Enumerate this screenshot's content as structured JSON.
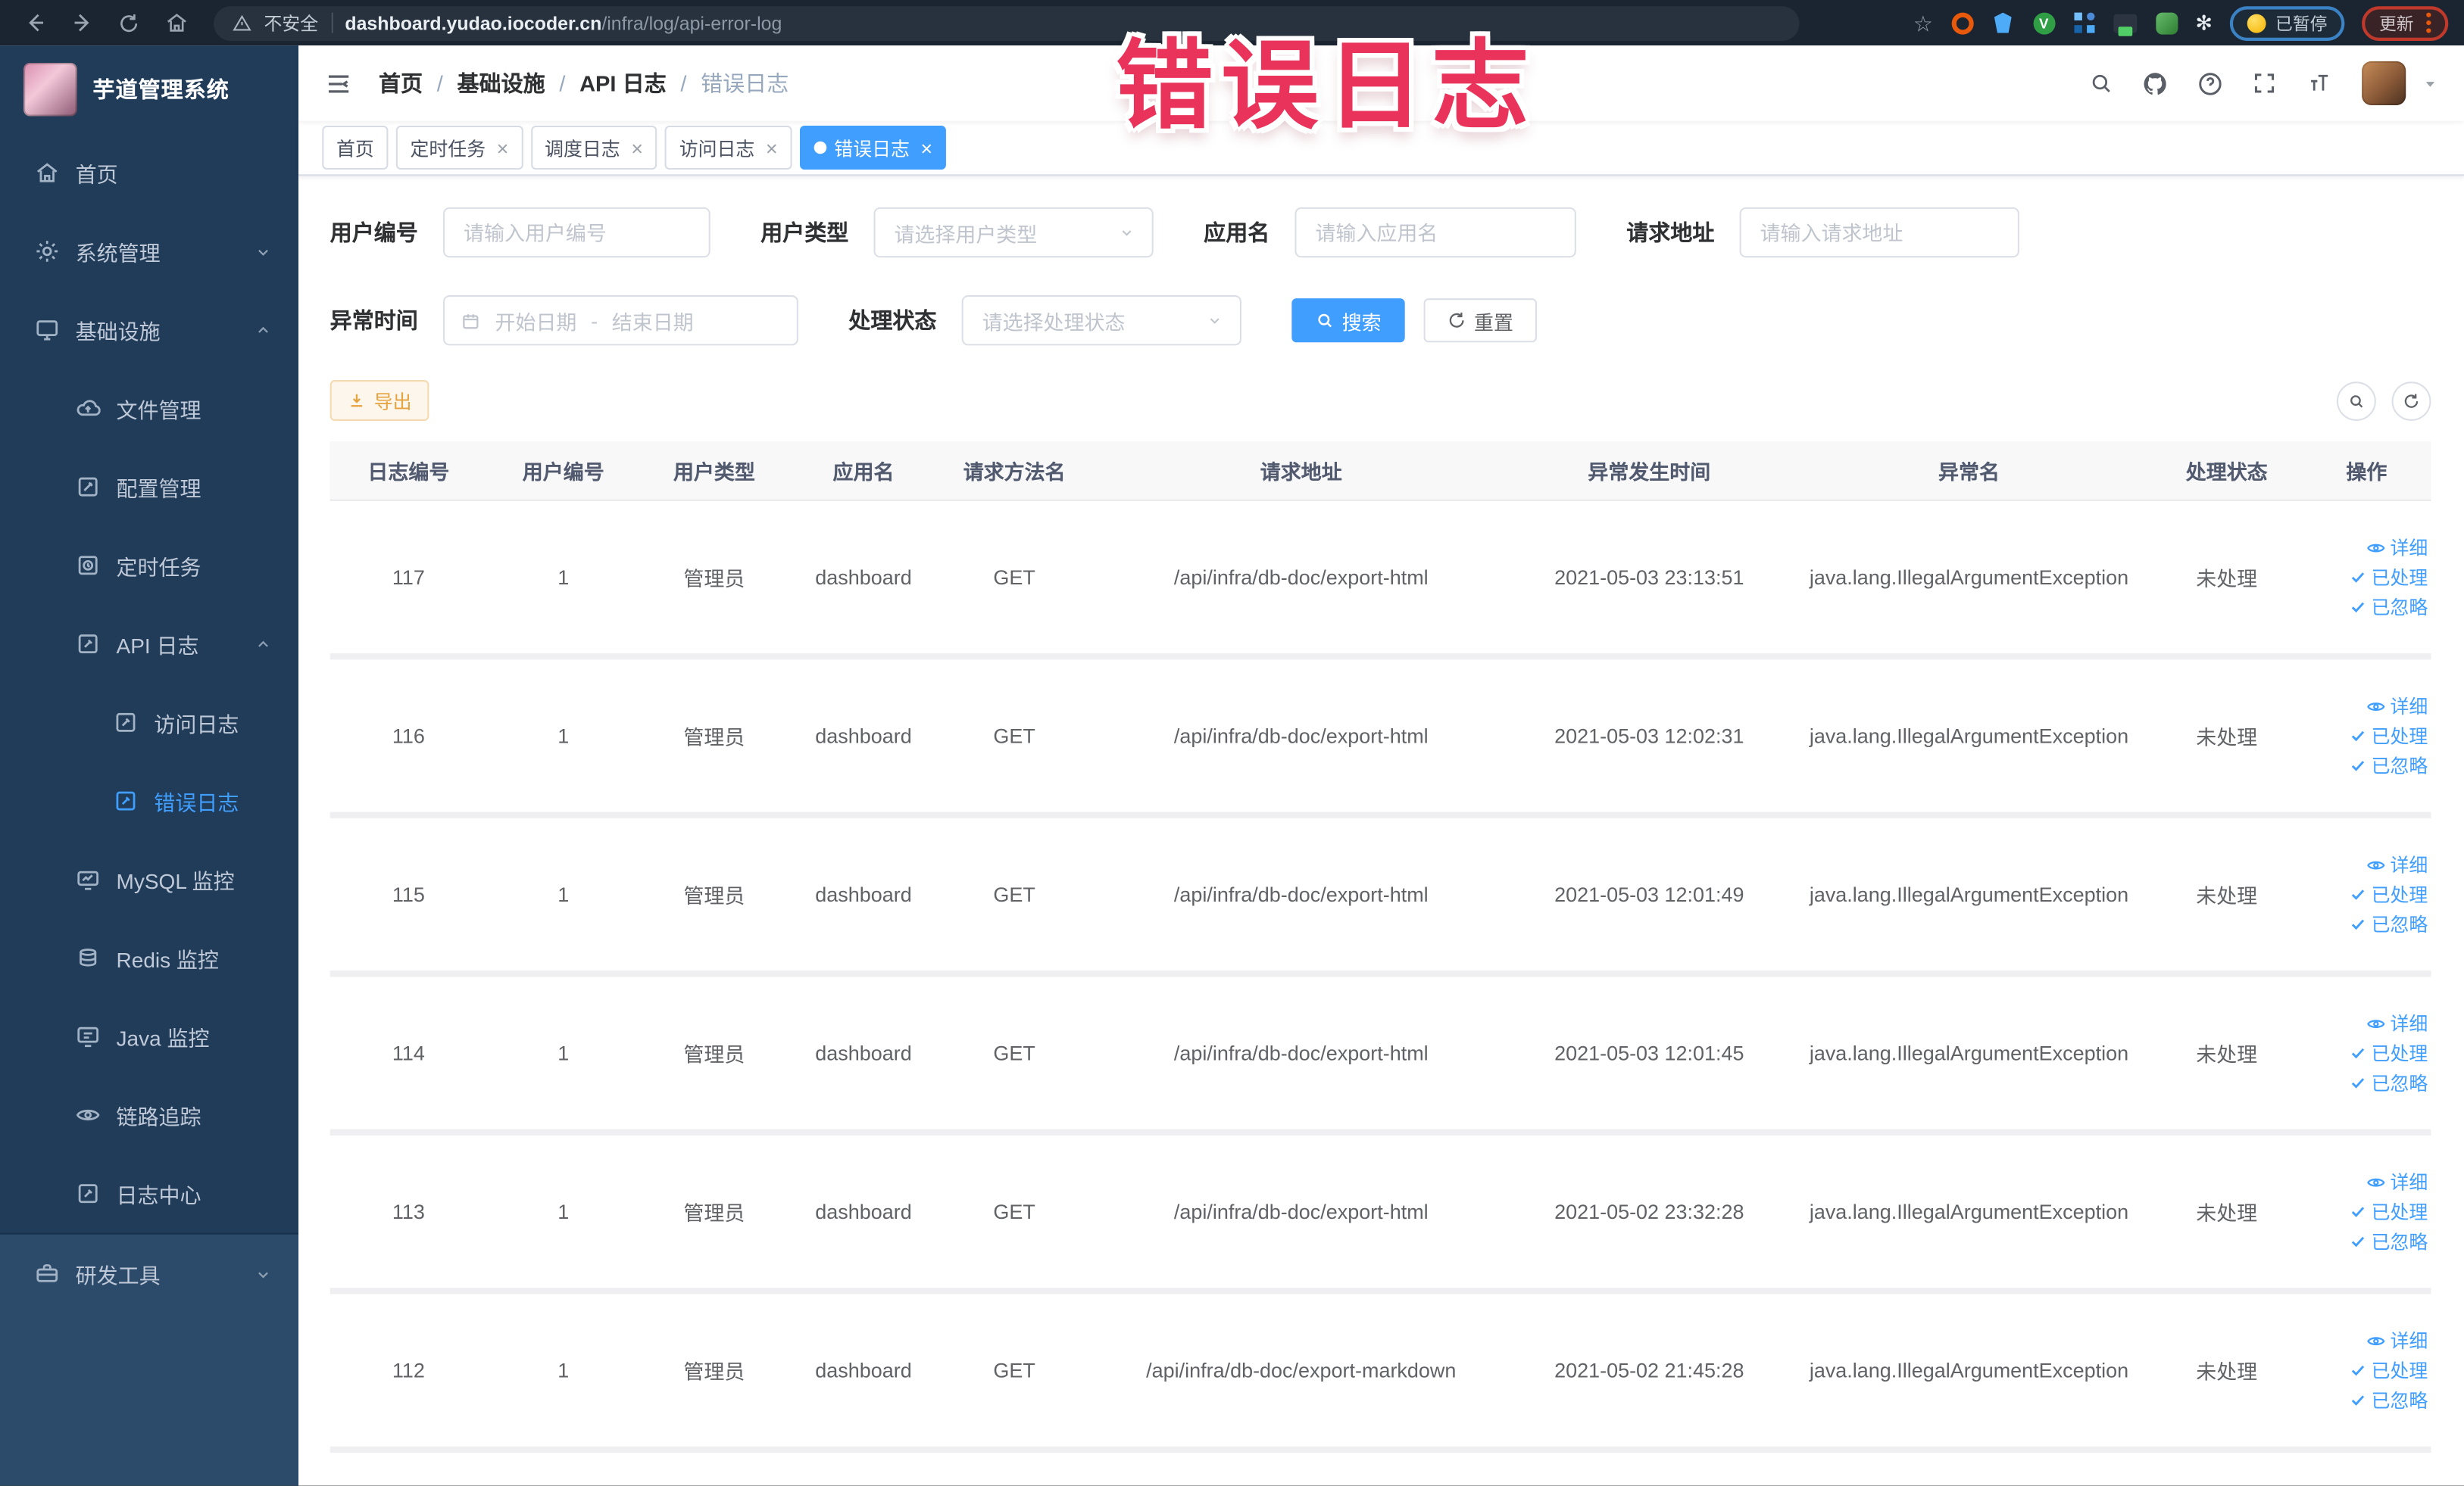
{
  "overlay": {
    "title": "错误日志"
  },
  "colors": {
    "accent": "#409eff",
    "warning": "#e6a23c",
    "overlay_red": "#ea335b",
    "sidebar_bg": "#203c59"
  },
  "browser": {
    "security_label": "不安全",
    "url_host": "dashboard.yudao.iocoder.cn",
    "url_path": "/infra/log/api-error-log",
    "paused_label": "已暂停",
    "update_label": "更新"
  },
  "sidebar": {
    "app_title": "芋道管理系统",
    "items": [
      {
        "key": "home",
        "label": "首页",
        "icon": "home",
        "level": 0
      },
      {
        "key": "system",
        "label": "系统管理",
        "icon": "gear",
        "level": 0,
        "chevron": "down"
      },
      {
        "key": "infra",
        "label": "基础设施",
        "icon": "monitor",
        "level": 0,
        "chevron": "up"
      },
      {
        "key": "file",
        "label": "文件管理",
        "icon": "cloud",
        "level": 1
      },
      {
        "key": "config",
        "label": "配置管理",
        "icon": "edit",
        "level": 1
      },
      {
        "key": "job",
        "label": "定时任务",
        "icon": "schedule",
        "level": 1
      },
      {
        "key": "api-log",
        "label": "API 日志",
        "icon": "log",
        "level": 1,
        "chevron": "up"
      },
      {
        "key": "access-log",
        "label": "访问日志",
        "icon": "log",
        "level": 2
      },
      {
        "key": "error-log",
        "label": "错误日志",
        "icon": "log",
        "level": 2,
        "active": true
      },
      {
        "key": "mysql",
        "label": "MySQL 监控",
        "icon": "mysql",
        "level": 1
      },
      {
        "key": "redis",
        "label": "Redis 监控",
        "icon": "redis",
        "level": 1
      },
      {
        "key": "java",
        "label": "Java 监控",
        "icon": "java",
        "level": 1
      },
      {
        "key": "trace",
        "label": "链路追踪",
        "icon": "eye",
        "level": 1
      },
      {
        "key": "log-center",
        "label": "日志中心",
        "icon": "log",
        "level": 1
      },
      {
        "key": "dev-tool",
        "label": "研发工具",
        "icon": "toolbox",
        "level": 0,
        "chevron": "down",
        "section": "light"
      }
    ]
  },
  "navbar": {
    "breadcrumb": [
      "首页",
      "基础设施",
      "API 日志",
      "错误日志"
    ],
    "separator": "/"
  },
  "tabs": [
    {
      "label": "首页",
      "closable": false,
      "active": false
    },
    {
      "label": "定时任务",
      "closable": true,
      "active": false
    },
    {
      "label": "调度日志",
      "closable": true,
      "active": false
    },
    {
      "label": "访问日志",
      "closable": true,
      "active": false
    },
    {
      "label": "错误日志",
      "closable": true,
      "active": true
    }
  ],
  "filters": {
    "user_id_label": "用户编号",
    "user_id_placeholder": "请输入用户编号",
    "user_type_label": "用户类型",
    "user_type_placeholder": "请选择用户类型",
    "app_label": "应用名",
    "app_placeholder": "请输入应用名",
    "url_label": "请求地址",
    "url_placeholder": "请输入请求地址",
    "time_label": "异常时间",
    "time_start_placeholder": "开始日期",
    "time_separator": "-",
    "time_end_placeholder": "结束日期",
    "status_label": "处理状态",
    "status_placeholder": "请选择处理状态",
    "search_label": "搜索",
    "reset_label": "重置"
  },
  "toolbar": {
    "export_label": "导出"
  },
  "table": {
    "headers": [
      "日志编号",
      "用户编号",
      "用户类型",
      "应用名",
      "请求方法名",
      "请求地址",
      "异常发生时间",
      "异常名",
      "处理状态",
      "操作"
    ],
    "actions": {
      "detail": "详细",
      "processed": "已处理",
      "ignored": "已忽略"
    },
    "rows": [
      {
        "id": "117",
        "user_id": "1",
        "user_type": "管理员",
        "app": "dashboard",
        "method": "GET",
        "url": "/api/infra/db-doc/export-html",
        "time": "2021-05-03 23:13:51",
        "exception": "java.lang.IllegalArgumentException",
        "status": "未处理"
      },
      {
        "id": "116",
        "user_id": "1",
        "user_type": "管理员",
        "app": "dashboard",
        "method": "GET",
        "url": "/api/infra/db-doc/export-html",
        "time": "2021-05-03 12:02:31",
        "exception": "java.lang.IllegalArgumentException",
        "status": "未处理"
      },
      {
        "id": "115",
        "user_id": "1",
        "user_type": "管理员",
        "app": "dashboard",
        "method": "GET",
        "url": "/api/infra/db-doc/export-html",
        "time": "2021-05-03 12:01:49",
        "exception": "java.lang.IllegalArgumentException",
        "status": "未处理"
      },
      {
        "id": "114",
        "user_id": "1",
        "user_type": "管理员",
        "app": "dashboard",
        "method": "GET",
        "url": "/api/infra/db-doc/export-html",
        "time": "2021-05-03 12:01:45",
        "exception": "java.lang.IllegalArgumentException",
        "status": "未处理"
      },
      {
        "id": "113",
        "user_id": "1",
        "user_type": "管理员",
        "app": "dashboard",
        "method": "GET",
        "url": "/api/infra/db-doc/export-html",
        "time": "2021-05-02 23:32:28",
        "exception": "java.lang.IllegalArgumentException",
        "status": "未处理"
      },
      {
        "id": "112",
        "user_id": "1",
        "user_type": "管理员",
        "app": "dashboard",
        "method": "GET",
        "url": "/api/infra/db-doc/export-markdown",
        "time": "2021-05-02 21:45:28",
        "exception": "java.lang.IllegalArgumentException",
        "status": "未处理"
      }
    ]
  }
}
